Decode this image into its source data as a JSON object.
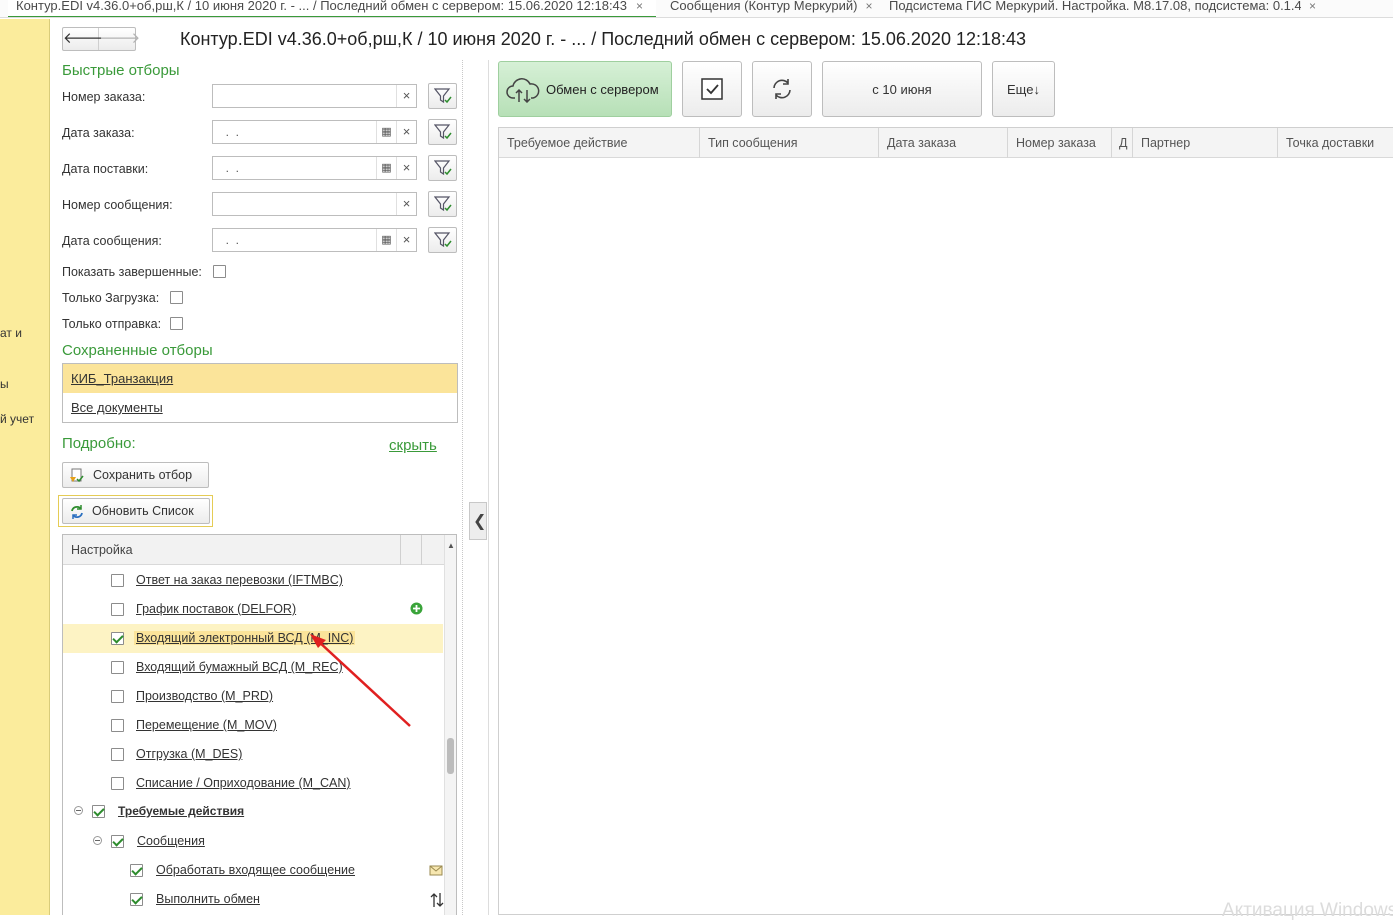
{
  "tabs": [
    {
      "label": "Контур.EDI v4.36.0+об,рш,К /  10 июня 2020 г. - ... / Последний обмен с сервером: 15.06.2020 12:18:43",
      "active": true
    },
    {
      "label": "Сообщения (Контур Меркурий)",
      "active": false
    },
    {
      "label": "Подсистема ГИС Меркурий. Настройка. М8.17.08, подсистема: 0.1.4",
      "active": false
    }
  ],
  "tab_close": "×",
  "sidebar": {
    "fragments": [
      "ат и",
      "ы",
      "й учет"
    ]
  },
  "nav": {
    "back": "🡐",
    "forward": "🡒"
  },
  "page_title": "Контур.EDI v4.36.0+об,рш,К /  10 июня 2020 г. - ... / Последний обмен с сервером: 15.06.2020 12:18:43",
  "quick_filters": {
    "title": "Быстрые отборы",
    "order_number": {
      "label": "Номер заказа:",
      "value": ""
    },
    "order_date": {
      "label": "Дата заказа:",
      "value": "  .  ."
    },
    "delivery_date": {
      "label": "Дата поставки:",
      "value": "  .  ."
    },
    "message_number": {
      "label": "Номер сообщения:",
      "value": ""
    },
    "message_date": {
      "label": "Дата сообщения:",
      "value": "  .  ."
    },
    "show_completed": {
      "label": "Показать завершенные:",
      "checked": false
    },
    "only_load": {
      "label": "Только Загрузка:",
      "checked": false
    },
    "only_send": {
      "label": "Только отправка:",
      "checked": false
    },
    "clear_glyph": "×",
    "calendar_glyph": "▦"
  },
  "saved_filters": {
    "title": "Сохраненные отборы",
    "items": [
      "КИБ_Транзакция",
      "Все документы"
    ]
  },
  "details": {
    "title": "Подробно:",
    "hide_link": "скрыть"
  },
  "buttons": {
    "save_filter": "Сохранить отбор",
    "refresh_list": "Обновить Список"
  },
  "settings_tree": {
    "header": "Настройка",
    "rows": [
      {
        "label": "Ответ на заказ перевозки (IFTMBC)",
        "checked": false
      },
      {
        "label": "График поставок (DELFOR)",
        "checked": false
      },
      {
        "label": "Входящий электронный ВСД (M_INC)",
        "checked": true
      },
      {
        "label": "Входящий бумажный ВСД (M_REC)",
        "checked": false
      },
      {
        "label": "Производство (M_PRD)",
        "checked": false
      },
      {
        "label": "Перемещение (M_MOV)",
        "checked": false
      },
      {
        "label": "Отгрузка (M_DES)",
        "checked": false
      },
      {
        "label": "Списание / Оприходование (M_CAN)",
        "checked": false
      },
      {
        "label": "Требуемые действия",
        "checked": true
      },
      {
        "label": "Сообщения",
        "checked": true
      },
      {
        "label": "Обработать входящее сообщение",
        "checked": true
      },
      {
        "label": "Выполнить обмен",
        "checked": true
      }
    ]
  },
  "toolbar": {
    "exchange": "Обмен с сервером",
    "period": "с 10 июня",
    "more": "Еще↓"
  },
  "grid_columns": [
    "Требуемое действие",
    "Тип сообщения",
    "Дата заказа",
    "Номер заказа",
    "Д",
    "Партнер",
    "Точка доставки"
  ],
  "watermark": "Активация Windows",
  "colors": {
    "accent_green": "#3a9a3a",
    "sidebar_yellow": "#fbec9c",
    "selection_yellow": "#fbe49a",
    "arrow_red": "#e02020"
  }
}
